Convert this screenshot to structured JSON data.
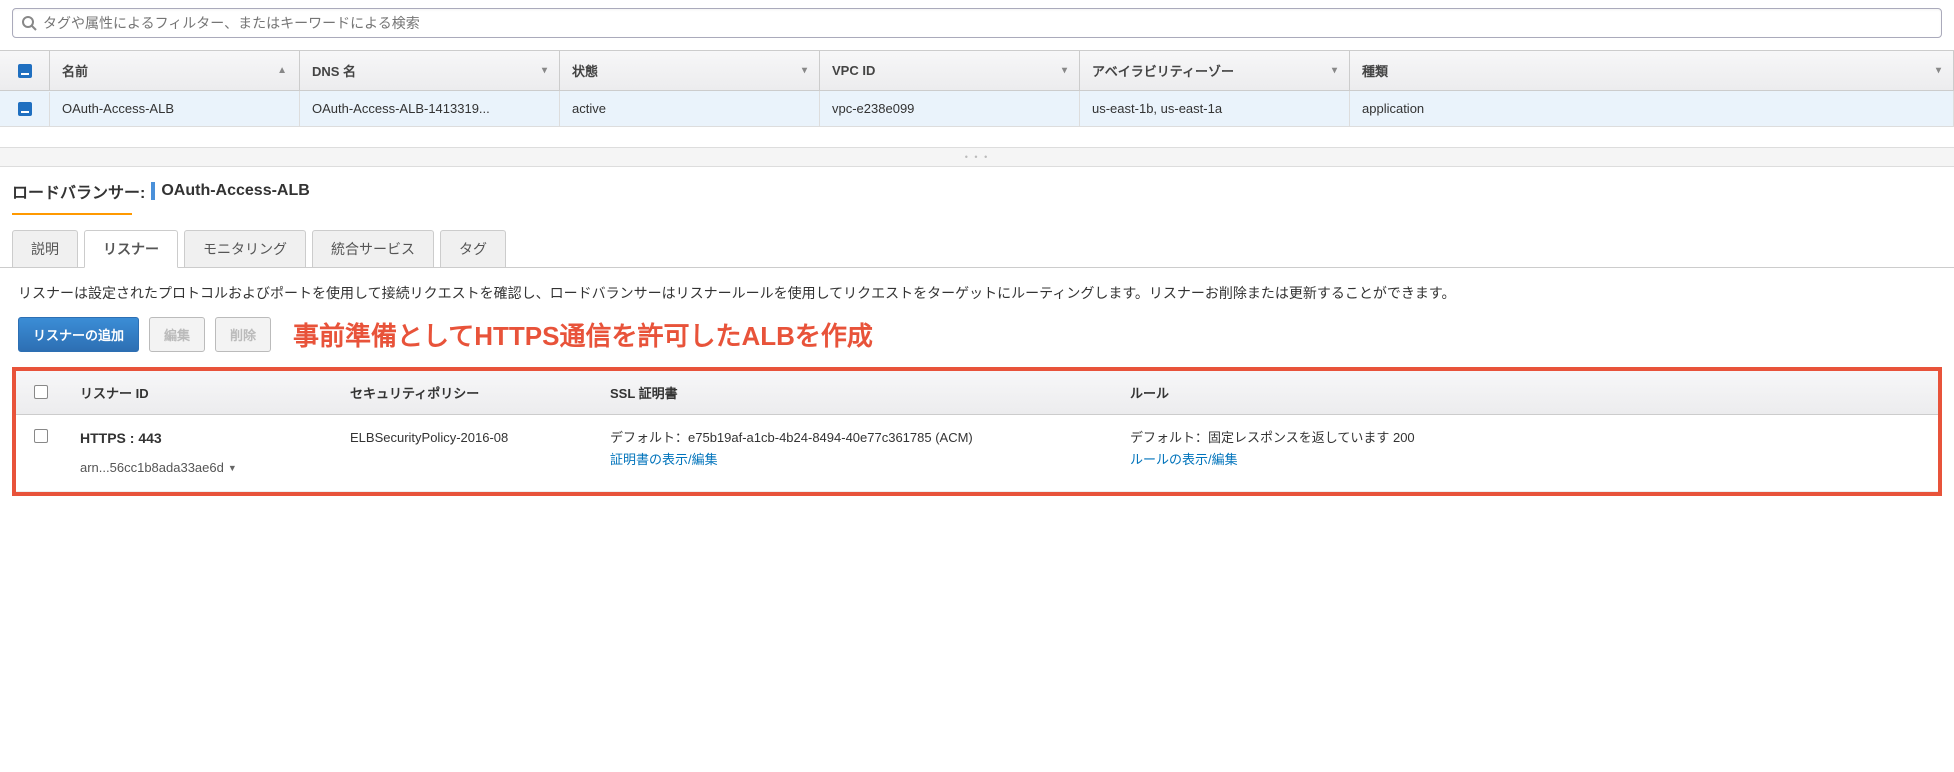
{
  "search": {
    "placeholder": "タグや属性によるフィルター、またはキーワードによる検索"
  },
  "columns": {
    "name": "名前",
    "dns": "DNS 名",
    "state": "状態",
    "vpc": "VPC ID",
    "az": "アベイラビリティーゾー",
    "type": "種類"
  },
  "row": {
    "name": "OAuth-Access-ALB",
    "dns": "OAuth-Access-ALB-1413319...",
    "state": "active",
    "vpc": "vpc-e238e099",
    "az": "us-east-1b, us-east-1a",
    "type": "application"
  },
  "detail": {
    "label_prefix": "ロードバランサー:",
    "name": "OAuth-Access-ALB"
  },
  "tabs": {
    "description": "説明",
    "listeners": "リスナー",
    "monitoring": "モニタリング",
    "integrated": "統合サービス",
    "tags": "タグ"
  },
  "listener_desc": "リスナーは設定されたプロトコルおよびポートを使用して接続リクエストを確認し、ロードバランサーはリスナールールを使用してリクエストをターゲットにルーティングします。リスナーお削除または更新することができます。",
  "buttons": {
    "add": "リスナーの追加",
    "edit": "編集",
    "delete": "削除"
  },
  "annotation": "事前準備としてHTTPS通信を許可したALBを作成",
  "listener_columns": {
    "id": "リスナー ID",
    "policy": "セキュリティポリシー",
    "ssl": "SSL 証明書",
    "rule": "ルール"
  },
  "listener_row": {
    "id_title": "HTTPS : 443",
    "arn": "arn...56cc1b8ada33ae6d",
    "policy": "ELBSecurityPolicy-2016-08",
    "ssl_default": "デフォルト：e75b19af-a1cb-4b24-8494-40e77c361785 (ACM)",
    "ssl_link": "証明書の表示/編集",
    "rule_default": "デフォルト：固定レスポンスを返しています 200",
    "rule_link": "ルールの表示/編集"
  }
}
